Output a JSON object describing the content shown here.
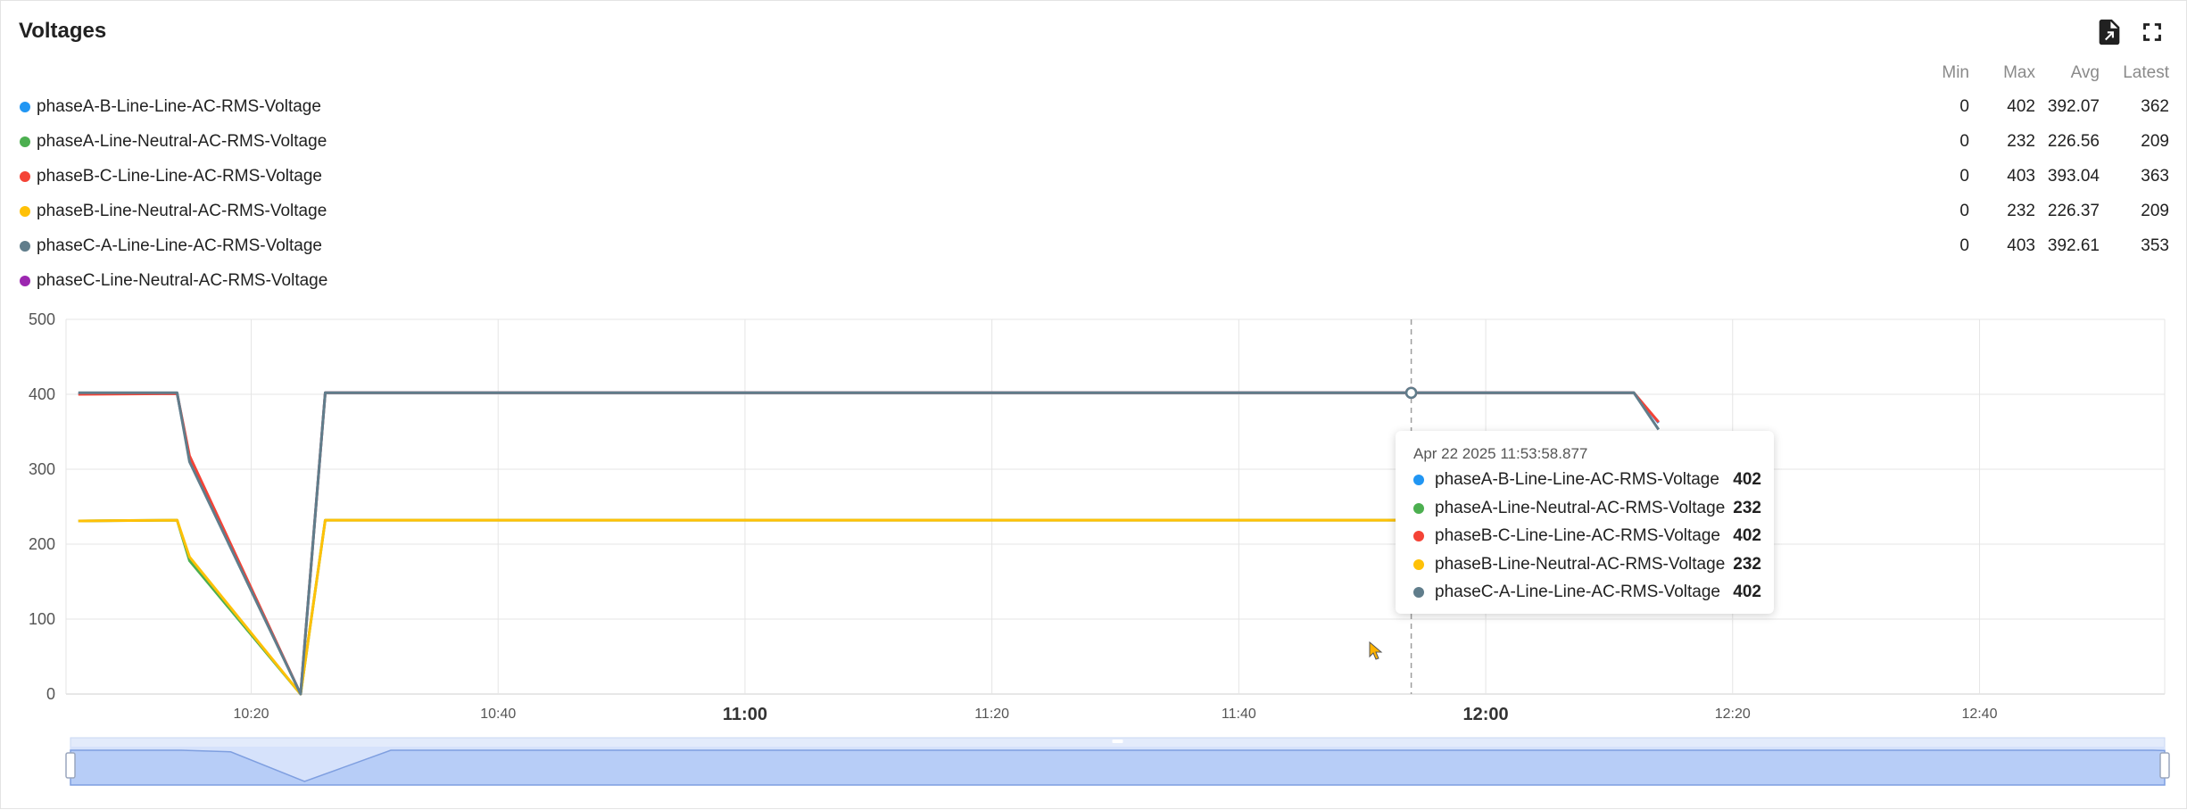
{
  "panel": {
    "title": "Voltages",
    "export_icon": "file-export-icon",
    "fullscreen_icon": "fullscreen-icon"
  },
  "legend": {
    "headers": [
      "Min",
      "Max",
      "Avg",
      "Latest"
    ],
    "rows": [
      {
        "name": "phaseA-B-Line-Line-AC-RMS-Voltage",
        "color": "#2196f3",
        "min": "0",
        "max": "402",
        "avg": "392.07",
        "latest": "362"
      },
      {
        "name": "phaseA-Line-Neutral-AC-RMS-Voltage",
        "color": "#4caf50",
        "min": "0",
        "max": "232",
        "avg": "226.56",
        "latest": "209"
      },
      {
        "name": "phaseB-C-Line-Line-AC-RMS-Voltage",
        "color": "#f44336",
        "min": "0",
        "max": "403",
        "avg": "393.04",
        "latest": "363"
      },
      {
        "name": "phaseB-Line-Neutral-AC-RMS-Voltage",
        "color": "#ffc107",
        "min": "0",
        "max": "232",
        "avg": "226.37",
        "latest": "209"
      },
      {
        "name": "phaseC-A-Line-Line-AC-RMS-Voltage",
        "color": "#607d8b",
        "min": "0",
        "max": "403",
        "avg": "392.61",
        "latest": "353"
      },
      {
        "name": "phaseC-Line-Neutral-AC-RMS-Voltage",
        "color": "#9c27b0",
        "min": "",
        "max": "",
        "avg": "",
        "latest": ""
      }
    ]
  },
  "tooltip": {
    "time": "Apr 22 2025 11:53:58.877",
    "rows": [
      {
        "name": "phaseA-B-Line-Line-AC-RMS-Voltage",
        "color": "#2196f3",
        "value": "402"
      },
      {
        "name": "phaseA-Line-Neutral-AC-RMS-Voltage",
        "color": "#4caf50",
        "value": "232"
      },
      {
        "name": "phaseB-C-Line-Line-AC-RMS-Voltage",
        "color": "#f44336",
        "value": "402"
      },
      {
        "name": "phaseB-Line-Neutral-AC-RMS-Voltage",
        "color": "#ffc107",
        "value": "232"
      },
      {
        "name": "phaseC-A-Line-Line-AC-RMS-Voltage",
        "color": "#607d8b",
        "value": "402"
      }
    ]
  },
  "chart_data": {
    "type": "line",
    "title": "Voltages",
    "xlabel": "",
    "ylabel": "",
    "xlim": [
      "10:05",
      "12:55"
    ],
    "ylim": [
      0,
      500
    ],
    "y_ticks": [
      0,
      100,
      200,
      300,
      400,
      500
    ],
    "x_ticks": [
      {
        "label": "10:20",
        "time": "10:20",
        "major": false
      },
      {
        "label": "10:40",
        "time": "10:40",
        "major": false
      },
      {
        "label": "11:00",
        "time": "11:00",
        "major": true
      },
      {
        "label": "11:20",
        "time": "11:20",
        "major": false
      },
      {
        "label": "11:40",
        "time": "11:40",
        "major": false
      },
      {
        "label": "12:00",
        "time": "12:00",
        "major": true
      },
      {
        "label": "12:20",
        "time": "12:20",
        "major": false
      },
      {
        "label": "12:40",
        "time": "12:40",
        "major": false
      }
    ],
    "grid": true,
    "cursor_time": "11:53:58",
    "series": [
      {
        "name": "phaseA-B-Line-Line-AC-RMS-Voltage",
        "color": "#2196f3",
        "points": [
          [
            "10:06",
            401
          ],
          [
            "10:14",
            401
          ],
          [
            "10:15",
            315
          ],
          [
            "10:24",
            0
          ],
          [
            "10:26",
            402
          ],
          [
            "12:12",
            402
          ],
          [
            "12:14",
            362
          ]
        ]
      },
      {
        "name": "phaseA-Line-Neutral-AC-RMS-Voltage",
        "color": "#4caf50",
        "points": [
          [
            "10:06",
            231
          ],
          [
            "10:14",
            232
          ],
          [
            "10:15",
            178
          ],
          [
            "10:24",
            0
          ],
          [
            "10:26",
            232
          ],
          [
            "12:12",
            232
          ],
          [
            "12:14",
            209
          ]
        ]
      },
      {
        "name": "phaseB-C-Line-Line-AC-RMS-Voltage",
        "color": "#f44336",
        "points": [
          [
            "10:06",
            400
          ],
          [
            "10:14",
            401
          ],
          [
            "10:15",
            318
          ],
          [
            "10:24",
            0
          ],
          [
            "10:26",
            402
          ],
          [
            "12:12",
            402
          ],
          [
            "12:14",
            363
          ]
        ]
      },
      {
        "name": "phaseB-Line-Neutral-AC-RMS-Voltage",
        "color": "#ffc107",
        "points": [
          [
            "10:06",
            231
          ],
          [
            "10:14",
            232
          ],
          [
            "10:15",
            183
          ],
          [
            "10:24",
            0
          ],
          [
            "10:26",
            232
          ],
          [
            "12:12",
            232
          ],
          [
            "12:14",
            209
          ]
        ]
      },
      {
        "name": "phaseC-A-Line-Line-AC-RMS-Voltage",
        "color": "#607d8b",
        "points": [
          [
            "10:06",
            402
          ],
          [
            "10:14",
            402
          ],
          [
            "10:15",
            310
          ],
          [
            "10:24",
            0
          ],
          [
            "10:26",
            402
          ],
          [
            "12:12",
            402
          ],
          [
            "12:14",
            353
          ]
        ]
      },
      {
        "name": "phaseC-Line-Neutral-AC-RMS-Voltage",
        "color": "#9c27b0",
        "points": []
      }
    ],
    "navigator_series": [
      [
        "10:05",
        401
      ],
      [
        "10:14",
        401
      ],
      [
        "10:18",
        365
      ],
      [
        "10:24",
        0
      ],
      [
        "10:31",
        402
      ],
      [
        "12:54",
        402
      ],
      [
        "12:55",
        380
      ]
    ]
  }
}
